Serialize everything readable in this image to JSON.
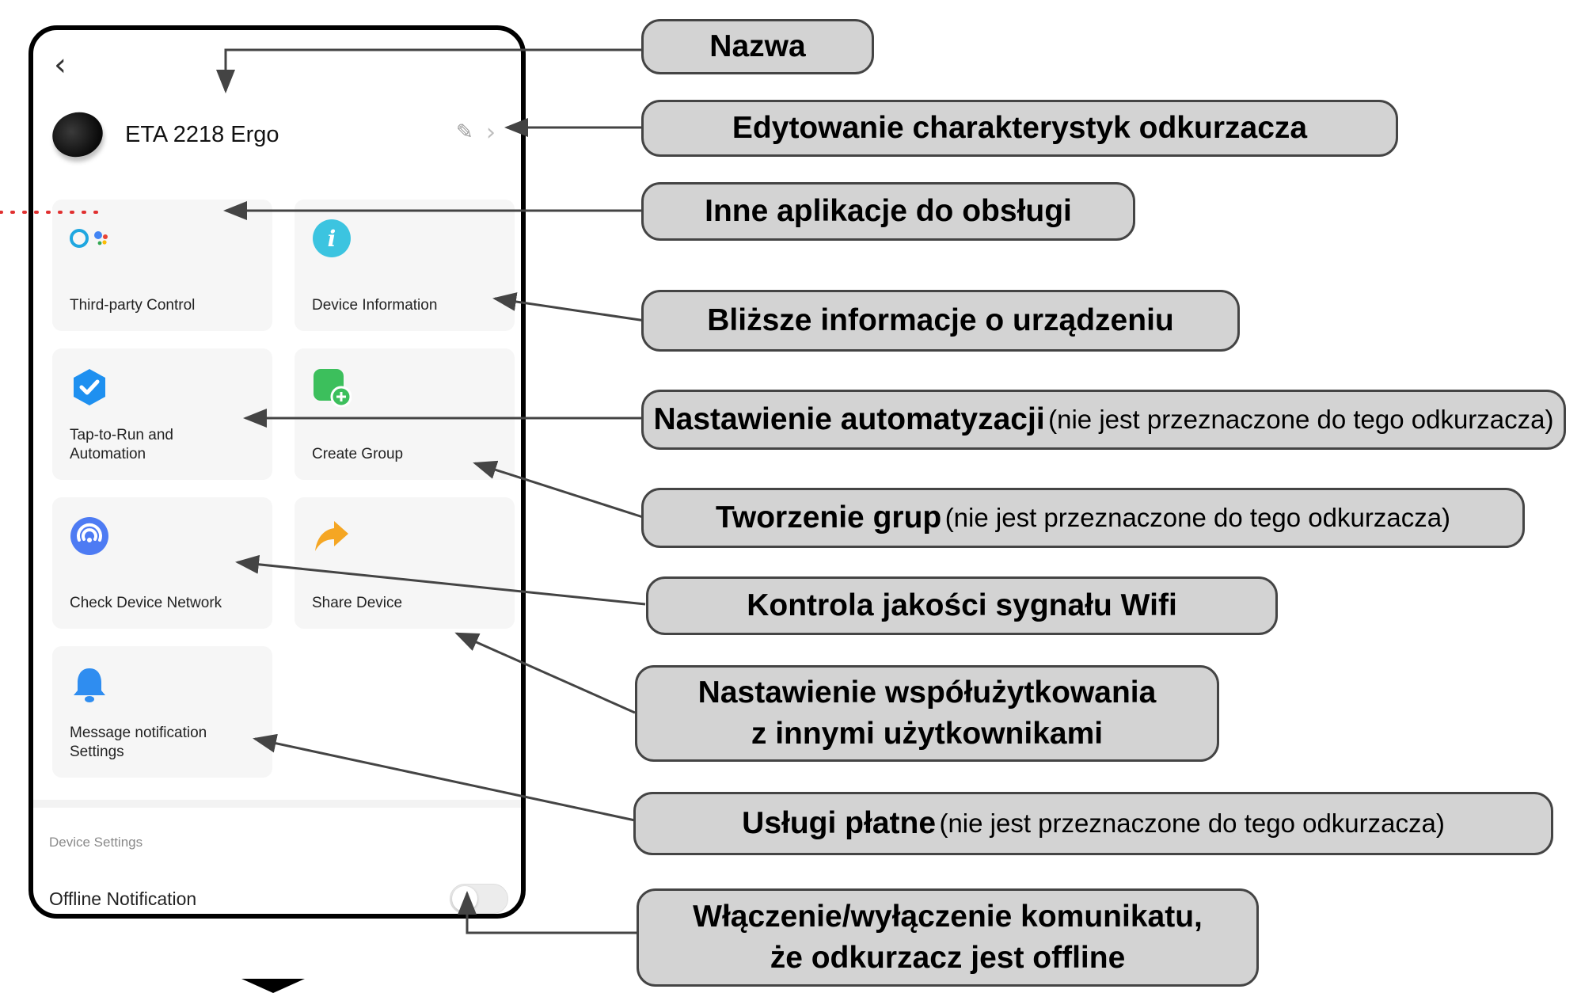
{
  "phone": {
    "back_glyph": "‹",
    "device_name": "ETA 2218 Ergo",
    "tiles": [
      {
        "label": "Third-party Control",
        "icon": "voice-assistants-icon"
      },
      {
        "label": "Device Information",
        "icon": "info-icon"
      },
      {
        "label": "Tap-to-Run and\nAutomation",
        "icon": "automation-check-icon"
      },
      {
        "label": "Create Group",
        "icon": "create-group-icon"
      },
      {
        "label": "Check Device Network",
        "icon": "network-signal-icon"
      },
      {
        "label": "Share Device",
        "icon": "share-arrow-icon"
      },
      {
        "label": "Message notification\nSettings",
        "icon": "bell-icon"
      }
    ],
    "device_settings_label": "Device Settings",
    "offline_notification_label": "Offline Notification",
    "offline_notification_on": false
  },
  "callouts": [
    {
      "bold": "Nazwa"
    },
    {
      "bold": "Edytowanie charakterystyk odkurzacza"
    },
    {
      "bold": "Inne aplikacje do obsługi"
    },
    {
      "bold": "Bliższe informacje o urządzeniu"
    },
    {
      "bold": "Nastawienie automatyzacji",
      "normal": "(nie jest przeznaczone do tego odkurzacza)"
    },
    {
      "bold": "Tworzenie grup",
      "normal": "(nie jest przeznaczone do tego odkurzacza)"
    },
    {
      "bold": "Kontrola jakości sygnału Wifi"
    },
    {
      "line1": "Nastawienie współużytkowania",
      "line2": "z innymi użytkownikami"
    },
    {
      "bold": "Usługi płatne",
      "normal": "(nie jest przeznaczone do tego odkurzacza)"
    },
    {
      "line1": "Włączenie/wyłączenie komunikatu,",
      "line2": "że odkurzacz jest offline"
    }
  ],
  "colors": {
    "callout_fill": "#d3d3d3",
    "arrow": "#444444",
    "dotted_line": "#e03030"
  }
}
